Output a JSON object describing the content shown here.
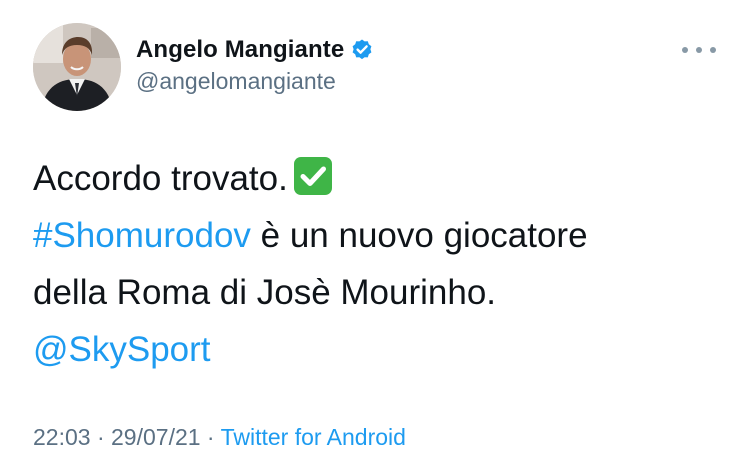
{
  "author": {
    "display_name": "Angelo Mangiante",
    "handle": "@angelomangiante",
    "verified": true
  },
  "tweet": {
    "line1_text": "Accordo trovato.",
    "line1_emoji": "check-mark-button-emoji",
    "hashtag": "#Shomurodov",
    "line2_rest": " è un nuovo giocatore",
    "line3_text": "della Roma di Josè Mourinho.",
    "mention": "@SkySport"
  },
  "meta": {
    "time": "22:03",
    "separator1": " · ",
    "date": "29/07/21",
    "separator2": " · ",
    "source": "Twitter for Android"
  },
  "colors": {
    "link": "#1d9bf0",
    "secondary_text": "#5b7083",
    "verified_badge": "#1d9bf0",
    "check_emoji": "#3fb547"
  }
}
